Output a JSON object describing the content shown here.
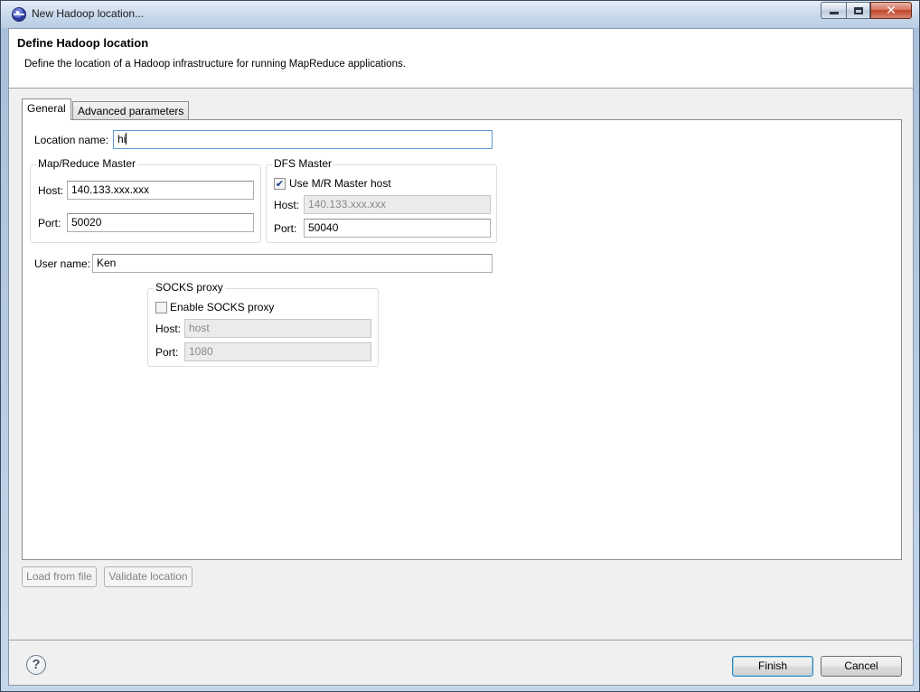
{
  "window": {
    "title": "New Hadoop location...",
    "icon": "eclipse-icon",
    "controls": {
      "minimize": "minimize",
      "maximize": "maximize",
      "close": "✕"
    }
  },
  "header": {
    "title": "Define Hadoop location",
    "description": "Define the location of a Hadoop infrastructure for running MapReduce applications."
  },
  "tabs": [
    {
      "label": "General",
      "selected": true
    },
    {
      "label": "Advanced parameters",
      "selected": false
    }
  ],
  "general": {
    "location_name": {
      "label": "Location name:",
      "value": "hi"
    },
    "mapreduce_master": {
      "title": "Map/Reduce Master",
      "host_label": "Host:",
      "host_value": "140.133.xxx.xxx",
      "port_label": "Port:",
      "port_value": "50020"
    },
    "dfs_master": {
      "title": "DFS Master",
      "use_mr_host_label": "Use M/R Master host",
      "use_mr_host_checked": true,
      "host_label": "Host:",
      "host_value": "140.133.xxx.xxx",
      "port_label": "Port:",
      "port_value": "50040"
    },
    "user_name": {
      "label": "User name:",
      "value": "Ken"
    },
    "socks_proxy": {
      "title": "SOCKS proxy",
      "enable_label": "Enable SOCKS proxy",
      "enable_checked": false,
      "host_label": "Host:",
      "host_value": "host",
      "port_label": "Port:",
      "port_value": "1080"
    }
  },
  "actions": {
    "load_from_file": "Load from file",
    "validate_location": "Validate location",
    "help": "?",
    "finish": "Finish",
    "cancel": "Cancel"
  },
  "colors": {
    "focus_border": "#5f9bd3",
    "default_button": "#3c7fb1"
  }
}
